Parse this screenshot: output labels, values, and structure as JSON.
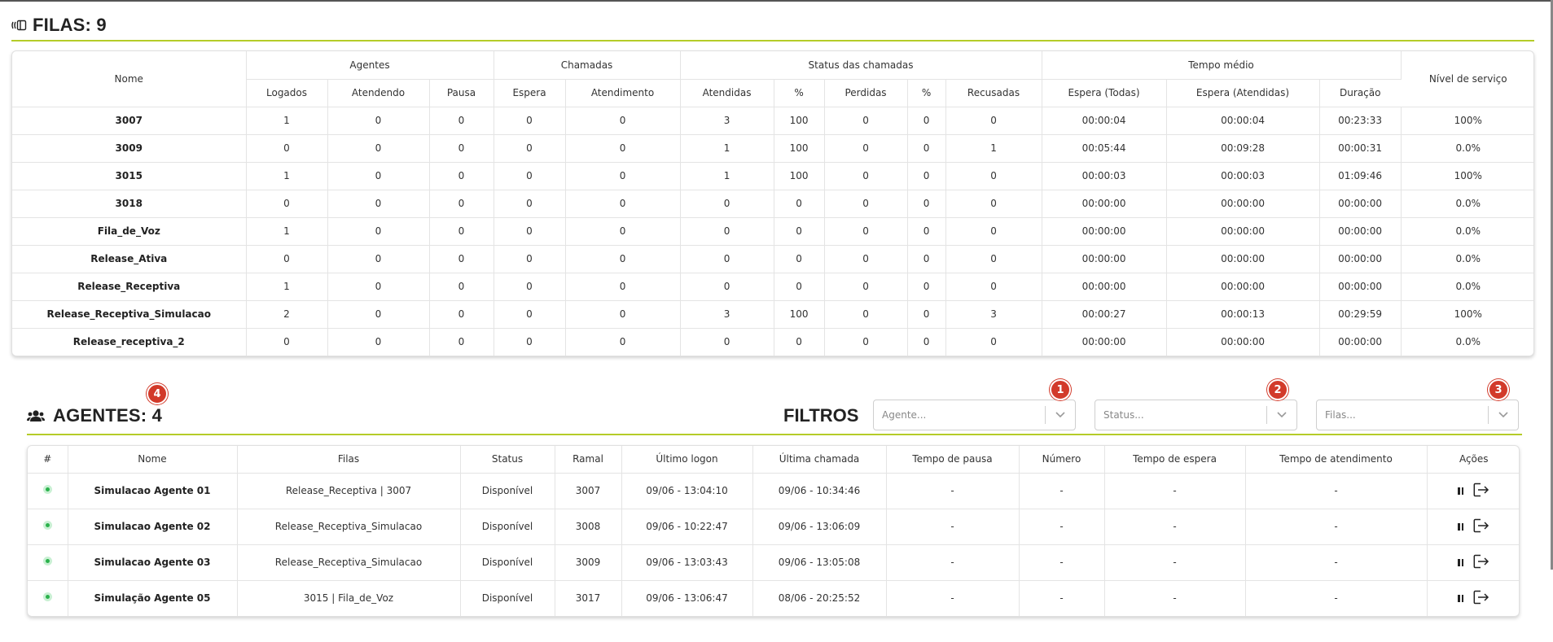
{
  "filas": {
    "title": "FILAS: 9",
    "headers": {
      "group": {
        "nome": "Nome",
        "agentes": "Agentes",
        "chamadas": "Chamadas",
        "status": "Status das chamadas",
        "tempo": "Tempo médio",
        "nivel": "Nível de serviço"
      },
      "sub": {
        "logados": "Logados",
        "atendendo": "Atendendo",
        "pausa": "Pausa",
        "espera": "Espera",
        "atendimento": "Atendimento",
        "atendidas": "Atendidas",
        "pct1": "%",
        "perdidas": "Perdidas",
        "pct2": "%",
        "recusadas": "Recusadas",
        "espera_todas": "Espera (Todas)",
        "espera_atendidas": "Espera (Atendidas)",
        "duracao": "Duração"
      }
    },
    "rows": [
      [
        "3007",
        "1",
        "0",
        "0",
        "0",
        "0",
        "3",
        "100",
        "0",
        "0",
        "0",
        "00:00:04",
        "00:00:04",
        "00:23:33",
        "100%"
      ],
      [
        "3009",
        "0",
        "0",
        "0",
        "0",
        "0",
        "1",
        "100",
        "0",
        "0",
        "1",
        "00:05:44",
        "00:09:28",
        "00:00:31",
        "0.0%"
      ],
      [
        "3015",
        "1",
        "0",
        "0",
        "0",
        "0",
        "1",
        "100",
        "0",
        "0",
        "0",
        "00:00:03",
        "00:00:03",
        "01:09:46",
        "100%"
      ],
      [
        "3018",
        "0",
        "0",
        "0",
        "0",
        "0",
        "0",
        "0",
        "0",
        "0",
        "0",
        "00:00:00",
        "00:00:00",
        "00:00:00",
        "0.0%"
      ],
      [
        "Fila_de_Voz",
        "1",
        "0",
        "0",
        "0",
        "0",
        "0",
        "0",
        "0",
        "0",
        "0",
        "00:00:00",
        "00:00:00",
        "00:00:00",
        "0.0%"
      ],
      [
        "Release_Ativa",
        "0",
        "0",
        "0",
        "0",
        "0",
        "0",
        "0",
        "0",
        "0",
        "0",
        "00:00:00",
        "00:00:00",
        "00:00:00",
        "0.0%"
      ],
      [
        "Release_Receptiva",
        "1",
        "0",
        "0",
        "0",
        "0",
        "0",
        "0",
        "0",
        "0",
        "0",
        "00:00:00",
        "00:00:00",
        "00:00:00",
        "0.0%"
      ],
      [
        "Release_Receptiva_Simulacao",
        "2",
        "0",
        "0",
        "0",
        "0",
        "3",
        "100",
        "0",
        "0",
        "3",
        "00:00:27",
        "00:00:13",
        "00:29:59",
        "100%"
      ],
      [
        "Release_receptiva_2",
        "0",
        "0",
        "0",
        "0",
        "0",
        "0",
        "0",
        "0",
        "0",
        "0",
        "00:00:00",
        "00:00:00",
        "00:00:00",
        "0.0%"
      ]
    ]
  },
  "agentes": {
    "title": "AGENTES: 4",
    "badge": "4",
    "filters": {
      "label": "FILTROS",
      "agente": {
        "placeholder": "Agente...",
        "badge": "1"
      },
      "status": {
        "placeholder": "Status...",
        "badge": "2"
      },
      "filas": {
        "placeholder": "Filas...",
        "badge": "3"
      }
    },
    "headers": [
      "#",
      "Nome",
      "Filas",
      "Status",
      "Ramal",
      "Último logon",
      "Última chamada",
      "Tempo de pausa",
      "Número",
      "Tempo de espera",
      "Tempo de atendimento",
      "Ações"
    ],
    "rows": [
      {
        "nome": "Simulacao Agente 01",
        "filas": "Release_Receptiva | 3007",
        "status": "Disponível",
        "ramal": "3007",
        "logon": "09/06 - 13:04:10",
        "chamada": "09/06 - 10:34:46",
        "pausa": "-",
        "numero": "-",
        "espera": "-",
        "atendimento": "-"
      },
      {
        "nome": "Simulacao Agente 02",
        "filas": "Release_Receptiva_Simulacao",
        "status": "Disponível",
        "ramal": "3008",
        "logon": "09/06 - 10:22:47",
        "chamada": "09/06 - 13:06:09",
        "pausa": "-",
        "numero": "-",
        "espera": "-",
        "atendimento": "-"
      },
      {
        "nome": "Simulacao Agente 03",
        "filas": "Release_Receptiva_Simulacao",
        "status": "Disponível",
        "ramal": "3009",
        "logon": "09/06 - 13:03:43",
        "chamada": "09/06 - 13:05:08",
        "pausa": "-",
        "numero": "-",
        "espera": "-",
        "atendimento": "-"
      },
      {
        "nome": "Simulação Agente 05",
        "filas": "3015 | Fila_de_Voz",
        "status": "Disponível",
        "ramal": "3017",
        "logon": "09/06 - 13:06:47",
        "chamada": "08/06 - 20:25:52",
        "pausa": "-",
        "numero": "-",
        "espera": "-",
        "atendimento": "-"
      }
    ]
  },
  "colors": {
    "accent": "#b5cc28",
    "badge": "#d23a2a",
    "online": "#2bb24c"
  },
  "icons": {
    "filas": "queue-icon",
    "agentes": "users-icon",
    "pause": "pause-icon",
    "logout": "logout-icon",
    "chevron": "chevron-down-icon"
  }
}
